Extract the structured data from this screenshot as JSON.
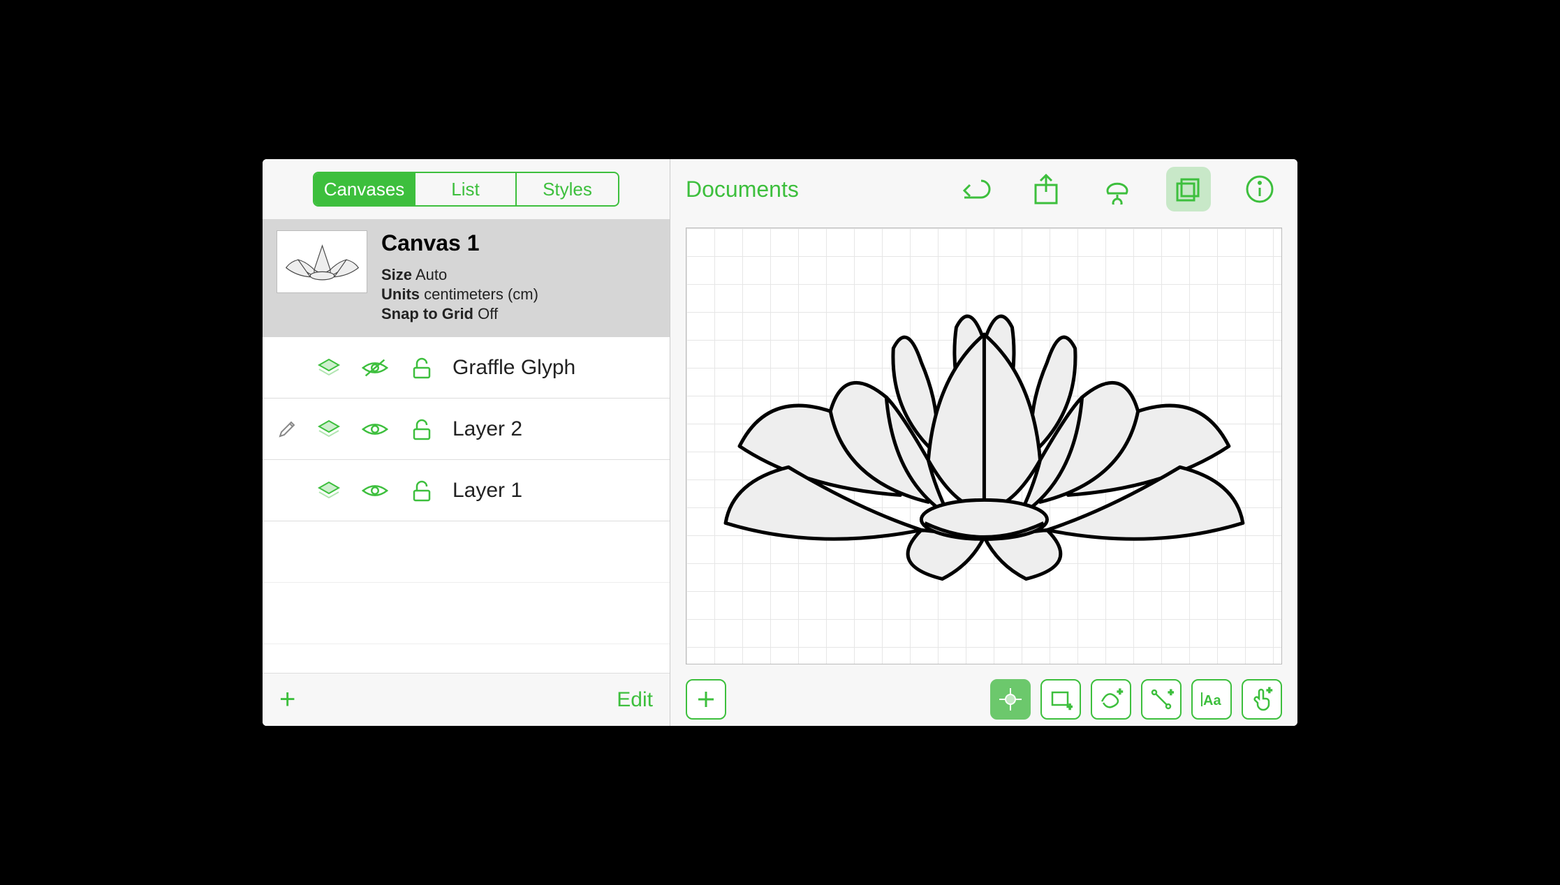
{
  "sidebar": {
    "tabs": [
      "Canvases",
      "List",
      "Styles"
    ],
    "active_tab": 0,
    "canvas": {
      "title": "Canvas 1",
      "size_label": "Size",
      "size_value": "Auto",
      "units_label": "Units",
      "units_value": "centimeters (cm)",
      "snap_label": "Snap to Grid",
      "snap_value": "Off"
    },
    "layers": [
      {
        "name": "Graffle Glyph",
        "visible": false,
        "editing": false
      },
      {
        "name": "Layer 2",
        "visible": true,
        "editing": true
      },
      {
        "name": "Layer 1",
        "visible": true,
        "editing": false
      }
    ],
    "add_label": "+",
    "edit_label": "Edit"
  },
  "header": {
    "documents_label": "Documents"
  },
  "colors": {
    "accent": "#3dbf3d"
  }
}
